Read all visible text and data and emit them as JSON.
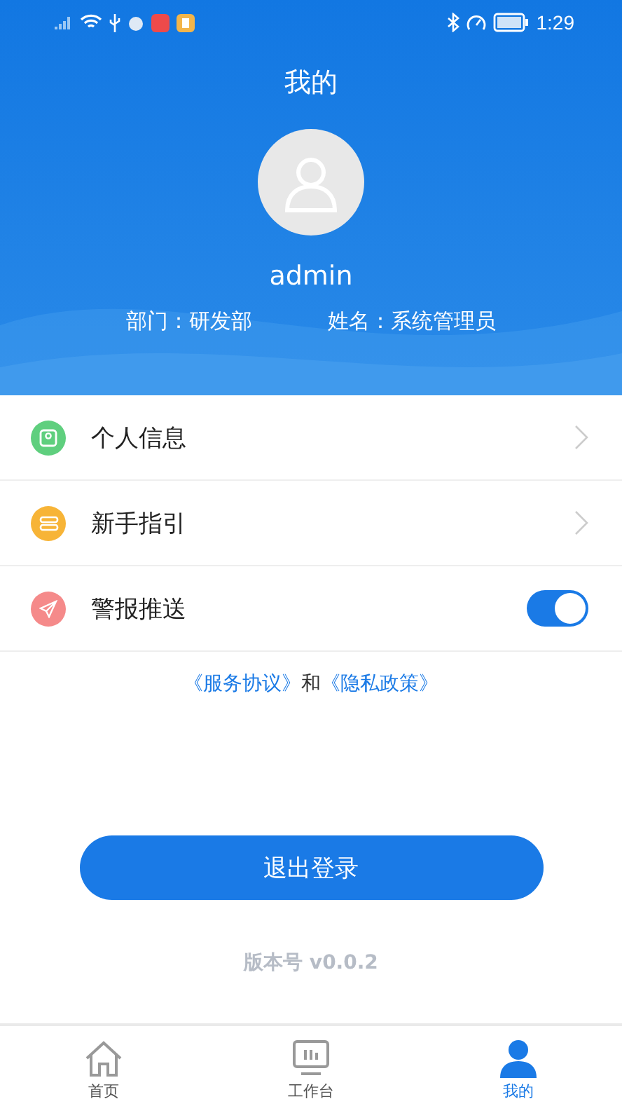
{
  "status_bar": {
    "time": "1:29"
  },
  "header": {
    "title": "我的",
    "username": "admin",
    "department": "部门：研发部",
    "name": "姓名：系统管理员"
  },
  "menu": [
    {
      "kind": "link",
      "label": "个人信息",
      "color": "#5fcf7e"
    },
    {
      "kind": "link",
      "label": "新手指引",
      "color": "#f7b437"
    },
    {
      "kind": "toggle",
      "label": "警报推送",
      "color": "#f58a8a",
      "on": true
    }
  ],
  "agreement": {
    "first": "《服务协议》",
    "joiner": "和",
    "second": "《隐私政策》"
  },
  "logout_button": "退出登录",
  "version": "版本号 v0.0.2",
  "tab_bar": [
    {
      "kind": "home",
      "label": "首页",
      "selected": false
    },
    {
      "kind": "workbench",
      "label": "工作台",
      "selected": false
    },
    {
      "kind": "profile",
      "label": "我的",
      "selected": true
    }
  ]
}
